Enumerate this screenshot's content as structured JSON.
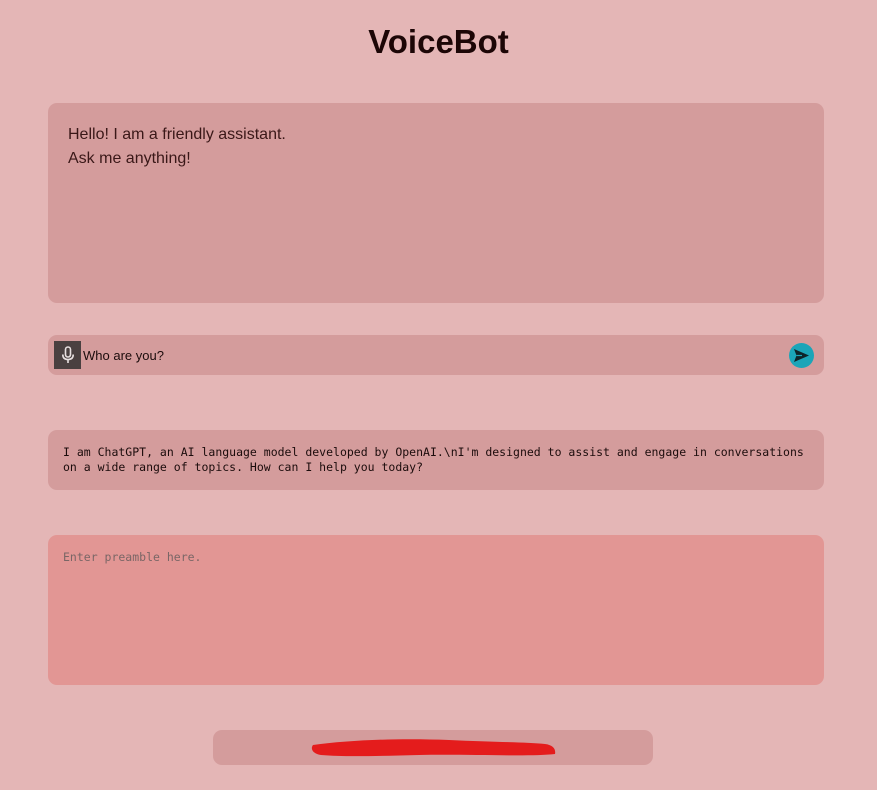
{
  "header": {
    "title": "VoiceBot"
  },
  "greeting": {
    "line1": "Hello! I am a friendly assistant.",
    "line2": "Ask me anything!"
  },
  "query": {
    "value": "Who are you?",
    "mic_icon": "microphone-icon",
    "send_icon": "send-icon"
  },
  "response": {
    "text": "I am ChatGPT, an AI language model developed by OpenAI.\\nI'm designed to assist and engage in conversations on a wide range of topics. How can I help you today?"
  },
  "preamble": {
    "placeholder": "Enter preamble here."
  },
  "colors": {
    "background": "#e4b6b6",
    "panel": "#d49c9c",
    "preamble": "#e29694",
    "send_button": "#1ba5b8",
    "mic_button": "#4a4040",
    "redaction": "#e41c1c"
  }
}
